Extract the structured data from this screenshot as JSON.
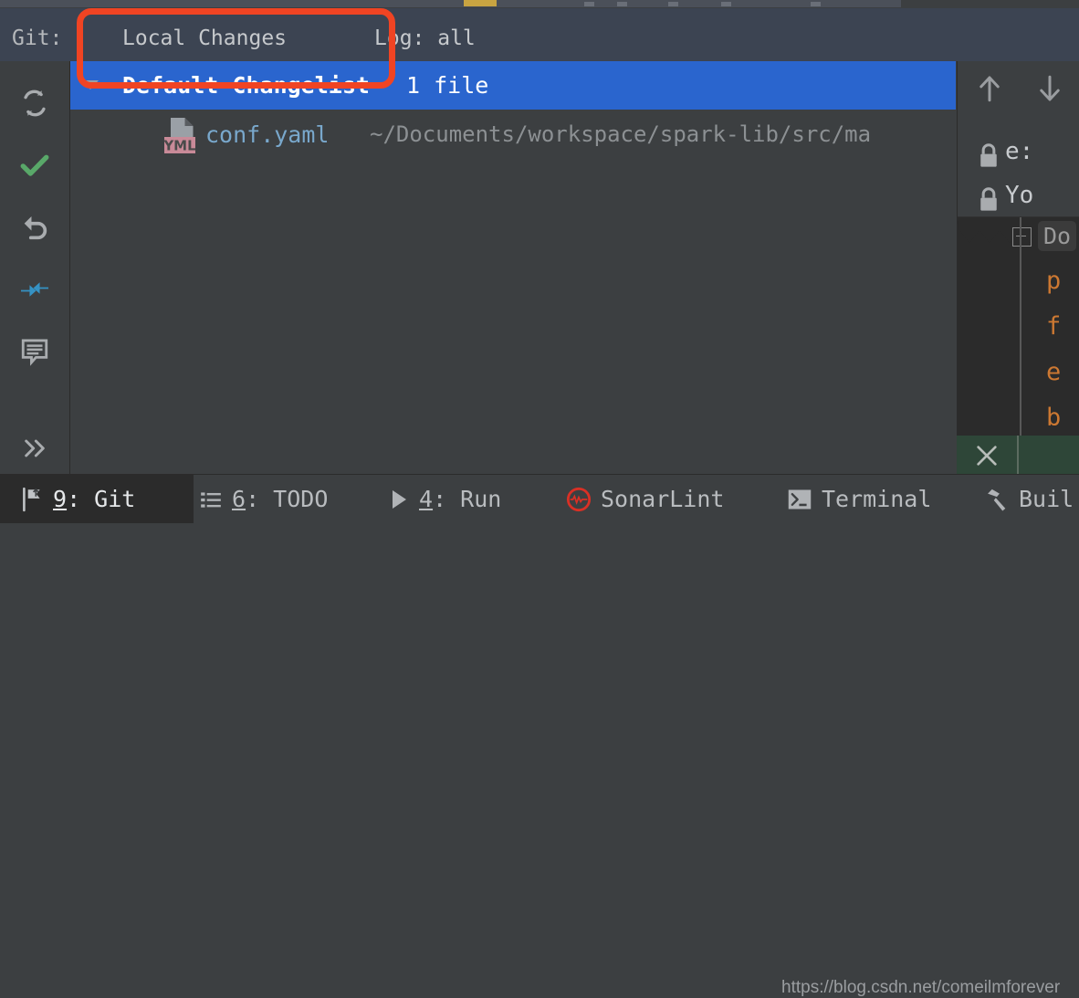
{
  "window": {
    "tool_window_label": "Git:",
    "tabs": [
      {
        "label": "Local Changes",
        "active": true
      },
      {
        "label": "Log: all",
        "active": false
      }
    ]
  },
  "toolbar": {
    "buttons": [
      {
        "name": "refresh-changes",
        "icon": "refresh-icon",
        "color": "#a9acaf"
      },
      {
        "name": "commit-changes",
        "icon": "checkmark-icon",
        "color": "#59a869"
      },
      {
        "name": "rollback-changes",
        "icon": "revert-icon",
        "color": "#a9acaf"
      },
      {
        "name": "show-diff",
        "icon": "diff-arrows-icon",
        "color": "#3592c4"
      },
      {
        "name": "edit-changelist",
        "icon": "comment-icon",
        "color": "#a9acaf"
      },
      {
        "name": "more-actions",
        "icon": "chevron-double-right-icon",
        "color": "#a9acaf"
      }
    ]
  },
  "changes": {
    "changelist": {
      "name": "Default Changelist",
      "count": "1 file",
      "selected": true,
      "expanded": true
    },
    "files": [
      {
        "icon": "yml-file-icon",
        "badge": "YML",
        "name": "conf.yaml",
        "path": "~/Documents/workspace/spark-lib/src/ma"
      }
    ]
  },
  "right_pane": {
    "nav": [
      {
        "icon": "arrow-up-icon",
        "name": "previous-change"
      },
      {
        "icon": "arrow-down-icon",
        "name": "next-change"
      }
    ],
    "locked_rows": [
      {
        "icon": "lock-icon",
        "text": "e:"
      },
      {
        "icon": "lock-icon",
        "text": "Yo"
      }
    ],
    "fold": {
      "icon": "fold-plus-icon",
      "label": "Do"
    },
    "code_lines": [
      "p",
      "f",
      "e",
      "b"
    ],
    "code_color": "#cc7832"
  },
  "notification": {
    "close_icon": "close-icon",
    "background": "#2e4638"
  },
  "status_bar": {
    "items": [
      {
        "num": "9",
        "sep": ": ",
        "label": "Git",
        "icon": "git-branch-icon",
        "active": true
      },
      {
        "num": "6",
        "sep": ": ",
        "label": "TODO",
        "icon": "list-icon",
        "active": false
      },
      {
        "num": "4",
        "sep": ": ",
        "label": "Run",
        "icon": "play-icon",
        "active": false
      },
      {
        "num": "",
        "sep": "",
        "label": "SonarLint",
        "icon": "sonarlint-icon",
        "active": false
      },
      {
        "num": "",
        "sep": "",
        "label": "Terminal",
        "icon": "terminal-icon",
        "active": false
      },
      {
        "num": "",
        "sep": "",
        "label": "Buil",
        "icon": "hammer-icon",
        "active": false
      }
    ]
  },
  "annotation": {
    "shape": "rounded-rectangle",
    "color": "#f04423",
    "targets": "Local Changes tab"
  },
  "watermark": "https://blog.csdn.net/comeilmforever",
  "colors": {
    "panel_bg": "#3c3f41",
    "header_bg": "#3c4452",
    "selection_blue": "#2a65ce",
    "tab_underline": "#5591d2",
    "editor_bg": "#2b2b2b",
    "link_blue": "#79a8cc",
    "green": "#2e4638"
  }
}
